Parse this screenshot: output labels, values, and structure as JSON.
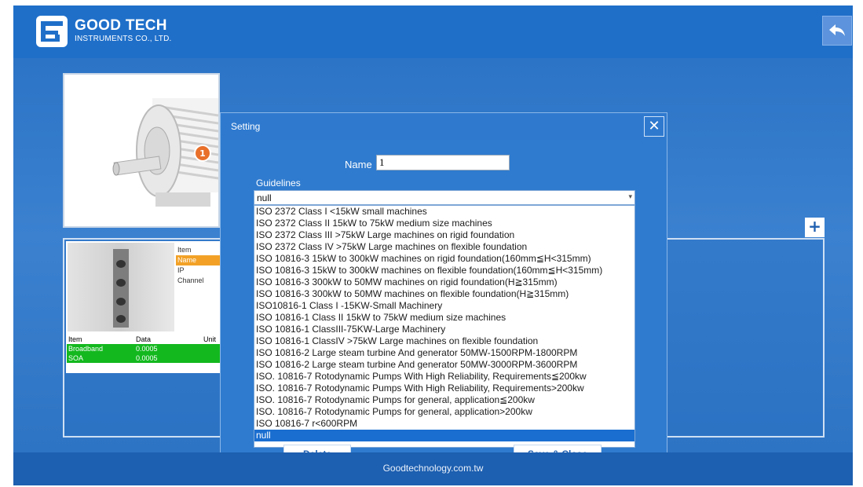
{
  "header": {
    "brand_name": "GOOD TECH",
    "brand_subtitle": "INSTRUMENTS CO., LTD.",
    "back_icon": "back-arrow-icon"
  },
  "footer": {
    "text": "Goodtechnology.com.tw"
  },
  "motor": {
    "marker_number": "1"
  },
  "device": {
    "labels": [
      "Item",
      "Name",
      "IP",
      "Channel"
    ],
    "selected_label_index": 1,
    "table_headers": [
      "Item",
      "Data",
      "Unit"
    ],
    "rows": [
      {
        "item": "Broadband",
        "data": "0.0005"
      },
      {
        "item": "SOA",
        "data": "0.0005"
      }
    ]
  },
  "add_button": {
    "label": "+"
  },
  "dialog": {
    "title": "Setting",
    "close_label": "✕",
    "name_label": "Name",
    "name_value": "1",
    "guidelines_label": "Guidelines",
    "guidelines_selected": "null",
    "options": [
      "ISO 2372 Class I  <15kW small machines",
      "ISO 2372 Class II  15kW to 75kW medium size machines",
      "ISO 2372 Class III  >75kW Large machines on rigid foundation",
      "ISO 2372 Class IV  >75kW Large machines on flexible foundation",
      "ISO 10816-3  15kW to 300kW machines on rigid foundation(160mm≦H<315mm)",
      "ISO 10816-3  15kW to 300kW machines on flexible foundation(160mm≦H<315mm)",
      "ISO 10816-3  300kW to 50MW machines on rigid foundation(H≧315mm)",
      "ISO 10816-3  300kW to 50MW machines on flexible foundation(H≧315mm)",
      "ISO10816-1  Class I -15KW-Small Machinery",
      "ISO 10816-1  Class II  15kW to 75kW medium size machines",
      "ISO 10816-1  ClassIII-75KW-Large Machinery",
      "ISO 10816-1  ClassIV  >75kW Large machines on flexible foundation",
      "ISO 10816-2 Large steam turbine And generator 50MW-1500RPM-1800RPM",
      "ISO 10816-2 Large steam turbine And generator 50MW-3000RPM-3600RPM",
      "ISO. 10816-7  Rotodynamic Pumps With High Reliability, Requirements≦200kw",
      "ISO. 10816-7 Rotodynamic Pumps With High Reliability, Requirements>200kw",
      "ISO. 10816-7 Rotodynamic Pumps for general, application≦200kw",
      "ISO. 10816-7 Rotodynamic Pumps for general, application>200kw",
      "ISO 10816-7 r<600RPM",
      "null"
    ],
    "highlighted_index": 19,
    "delete_label": "Delete",
    "save_label": "Save & Close"
  },
  "colors": {
    "primary_blue": "#2467b8",
    "header_blue": "#1f6fc9",
    "highlight": "#1a6ed0",
    "selected_orange": "#f2a126",
    "status_green": "#13b81e"
  }
}
